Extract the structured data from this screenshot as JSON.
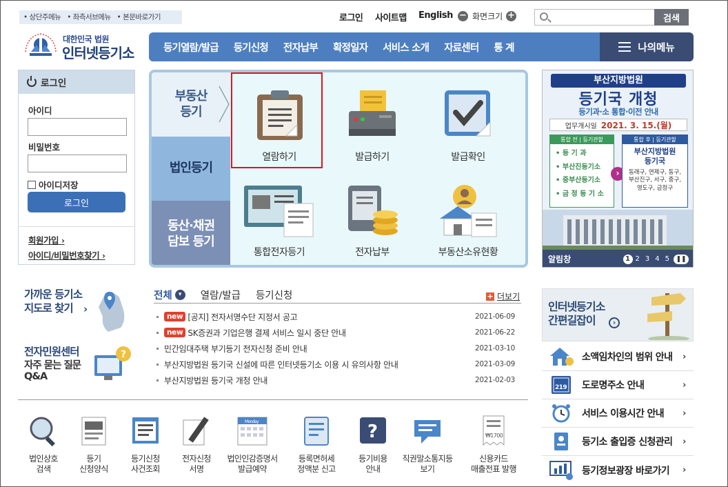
{
  "skip": [
    "상단주메뉴",
    "좌측서브메뉴",
    "본문바로가기"
  ],
  "util": {
    "login": "로그인",
    "sitemap": "사이트맵",
    "english": "English",
    "zoom_label": "화면크기",
    "zoom_out": "−",
    "zoom_in": "+"
  },
  "search": {
    "placeholder": "",
    "button": "검색"
  },
  "logo": {
    "sub": "대한민국 법원",
    "main": "인터넷등기소"
  },
  "nav": [
    "등기열람/발급",
    "등기신청",
    "전자납부",
    "확정일자",
    "서비스 소개",
    "자료센터",
    "통 계"
  ],
  "mymenu": "나의메뉴",
  "login": {
    "title": "로그인",
    "id_label": "아이디",
    "pw_label": "비밀번호",
    "remember": "아이디저장",
    "button": "로그인",
    "join": "회원가입",
    "find": "아이디/비밀번호찾기"
  },
  "services": {
    "tabs": [
      "부동산\n등기",
      "법인등기",
      "동산·채권\n담보 등기"
    ],
    "items": [
      "열람하기",
      "발급하기",
      "발급확인",
      "통합전자등기",
      "전자납부",
      "부동산소유현황"
    ]
  },
  "banner": {
    "line1": "부산지방법원",
    "line2": "등기국 개청",
    "line3": "등기과·소 통합·이전 안내",
    "date_label": "업무개시일",
    "date": "2021. 3. 15.(월)",
    "before_title": "통합 전 | 등기관할",
    "before": [
      "등 기 과",
      "부산진등기소",
      "중부산등기소",
      "금 정 등 기 소"
    ],
    "after_title": "통합 후 | 등기관할",
    "after_name": "부산지방법원\n등기국",
    "after_area": "동래구, 연제구, 동구, 부산진구, 서구, 중구, 영도구, 금정구",
    "footer": "알림창",
    "pages": [
      "1",
      "2",
      "3",
      "4",
      "5"
    ]
  },
  "left_links": {
    "gps": "가까운 등기소\n지도로 찾기",
    "center": "전자민원센터",
    "faq": "자주 묻는 질문\nQ&A"
  },
  "news": {
    "tabs": [
      "전체",
      "열람/발급",
      "등기신청"
    ],
    "more": "더보기",
    "new_badge": "new",
    "rows": [
      {
        "new": true,
        "title": "[공지] 전자서명수단 지정서 공고",
        "date": "2021-06-09"
      },
      {
        "new": true,
        "title": "SK증권과 기업은행 결제 서비스 일시 중단 안내",
        "date": "2021-06-22"
      },
      {
        "new": false,
        "title": "민간임대주택 부기등기 전자신청 준비 안내",
        "date": "2021-03-10"
      },
      {
        "new": false,
        "title": "부산지방법원 등기국 신설에 따른 인터넷등기소 이용 시 유의사항 안내",
        "date": "2021-03-09"
      },
      {
        "new": false,
        "title": "부산지방법원 등기국 개청 안내",
        "date": "2021-02-03"
      }
    ]
  },
  "bottom_icons": [
    "법인상호\n검색",
    "등기\n신청양식",
    "등기신청\n사건조회",
    "전자신청\n서명",
    "법인인감증명서\n발급예약",
    "등록면허세\n정액분 신고",
    "등기비용\n안내",
    "직권말소통지등\n보기",
    "신용카드\n매출전표 발행"
  ],
  "bottom_misc": {
    "calendar_label": "Monday",
    "receipt_amount": "₩1700"
  },
  "easy": "인터넷등기소\n간편길잡이",
  "quick": [
    "소액임차인의 범위 안내",
    "도로명주소 안내",
    "서비스 이용시간 안내",
    "등기소 출입증 신청관리",
    "등기정보광장 바로가기"
  ],
  "quick_misc": {
    "road_sign": "219"
  },
  "colors": {
    "nav": "#4d7fc0",
    "mymenu": "#3a4c74",
    "accent_red": "#e0141b",
    "login_btn": "#3b70b6"
  }
}
